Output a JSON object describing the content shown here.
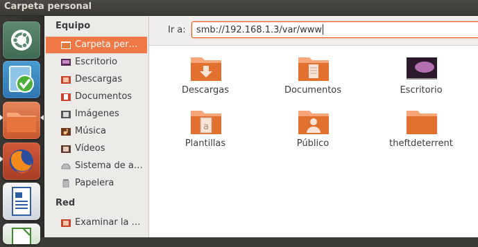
{
  "window": {
    "title": "Carpeta personal"
  },
  "launcher": {
    "items": [
      {
        "name": "Dash"
      },
      {
        "name": "Centro de software"
      },
      {
        "name": "Archivos"
      },
      {
        "name": "Firefox"
      },
      {
        "name": "Writer"
      },
      {
        "name": "Calc"
      }
    ]
  },
  "sidebar": {
    "equipo_title": "Equipo",
    "red_title": "Red",
    "items": [
      {
        "label": "Carpeta per…",
        "icon": "home-folder-icon",
        "selected": true
      },
      {
        "label": "Escritorio",
        "icon": "desktop-icon"
      },
      {
        "label": "Descargas",
        "icon": "downloads-icon"
      },
      {
        "label": "Documentos",
        "icon": "documents-icon"
      },
      {
        "label": "Imágenes",
        "icon": "pictures-icon"
      },
      {
        "label": "Música",
        "icon": "music-icon"
      },
      {
        "label": "Vídeos",
        "icon": "videos-icon"
      },
      {
        "label": "Sistema de a…",
        "icon": "drive-icon"
      },
      {
        "label": "Papelera",
        "icon": "trash-icon"
      }
    ],
    "network_items": [
      {
        "label": "Examinar la …",
        "icon": "network-icon"
      }
    ]
  },
  "location": {
    "label": "Ir a:",
    "value": "smb://192.168.1.3/var/www"
  },
  "files": [
    {
      "name": "Descargas",
      "icon": "folder-downloads-icon"
    },
    {
      "name": "Documentos",
      "icon": "folder-documents-icon"
    },
    {
      "name": "Escritorio",
      "icon": "folder-desktop-icon"
    },
    {
      "name": "Plantillas",
      "icon": "folder-templates-icon"
    },
    {
      "name": "Público",
      "icon": "folder-public-icon"
    },
    {
      "name": "theftdeterrent",
      "icon": "folder-icon"
    }
  ],
  "colors": {
    "accent": "#f07746",
    "launcher": "#3b3935",
    "folder": "#e2712f"
  }
}
